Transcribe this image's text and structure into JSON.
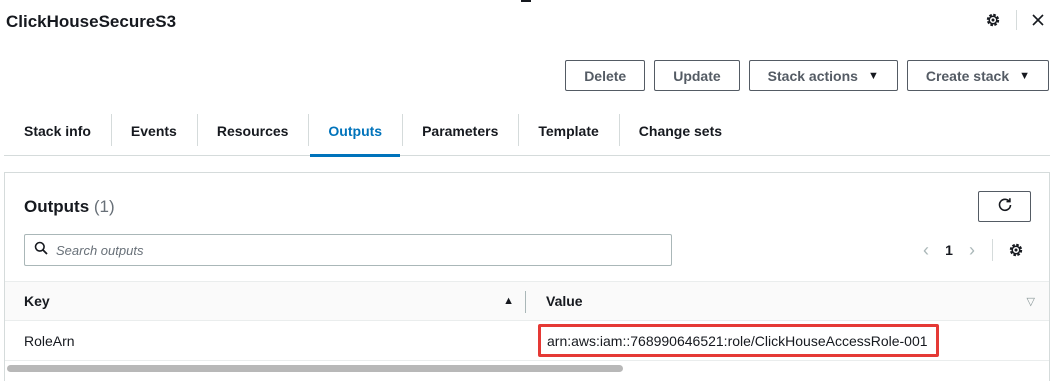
{
  "page": {
    "title": "ClickHouseSecureS3"
  },
  "header_icons": {
    "settings": "gear-icon",
    "close": "close-icon"
  },
  "actions": {
    "delete_label": "Delete",
    "update_label": "Update",
    "stack_actions_label": "Stack actions",
    "create_stack_label": "Create stack"
  },
  "tabs": [
    {
      "label": "Stack info",
      "active": false
    },
    {
      "label": "Events",
      "active": false
    },
    {
      "label": "Resources",
      "active": false
    },
    {
      "label": "Outputs",
      "active": true
    },
    {
      "label": "Parameters",
      "active": false
    },
    {
      "label": "Template",
      "active": false
    },
    {
      "label": "Change sets",
      "active": false
    }
  ],
  "outputs": {
    "title": "Outputs",
    "count": "(1)",
    "search_placeholder": "Search outputs",
    "current_page": "1",
    "columns": {
      "key": "Key",
      "value": "Value"
    },
    "rows": [
      {
        "key": "RoleArn",
        "value": "arn:aws:iam::768990646521:role/ClickHouseAccessRole-001",
        "highlighted": true
      }
    ]
  },
  "colors": {
    "accent": "#0073bb",
    "highlight_border": "#e53935",
    "text": "#16191f"
  }
}
